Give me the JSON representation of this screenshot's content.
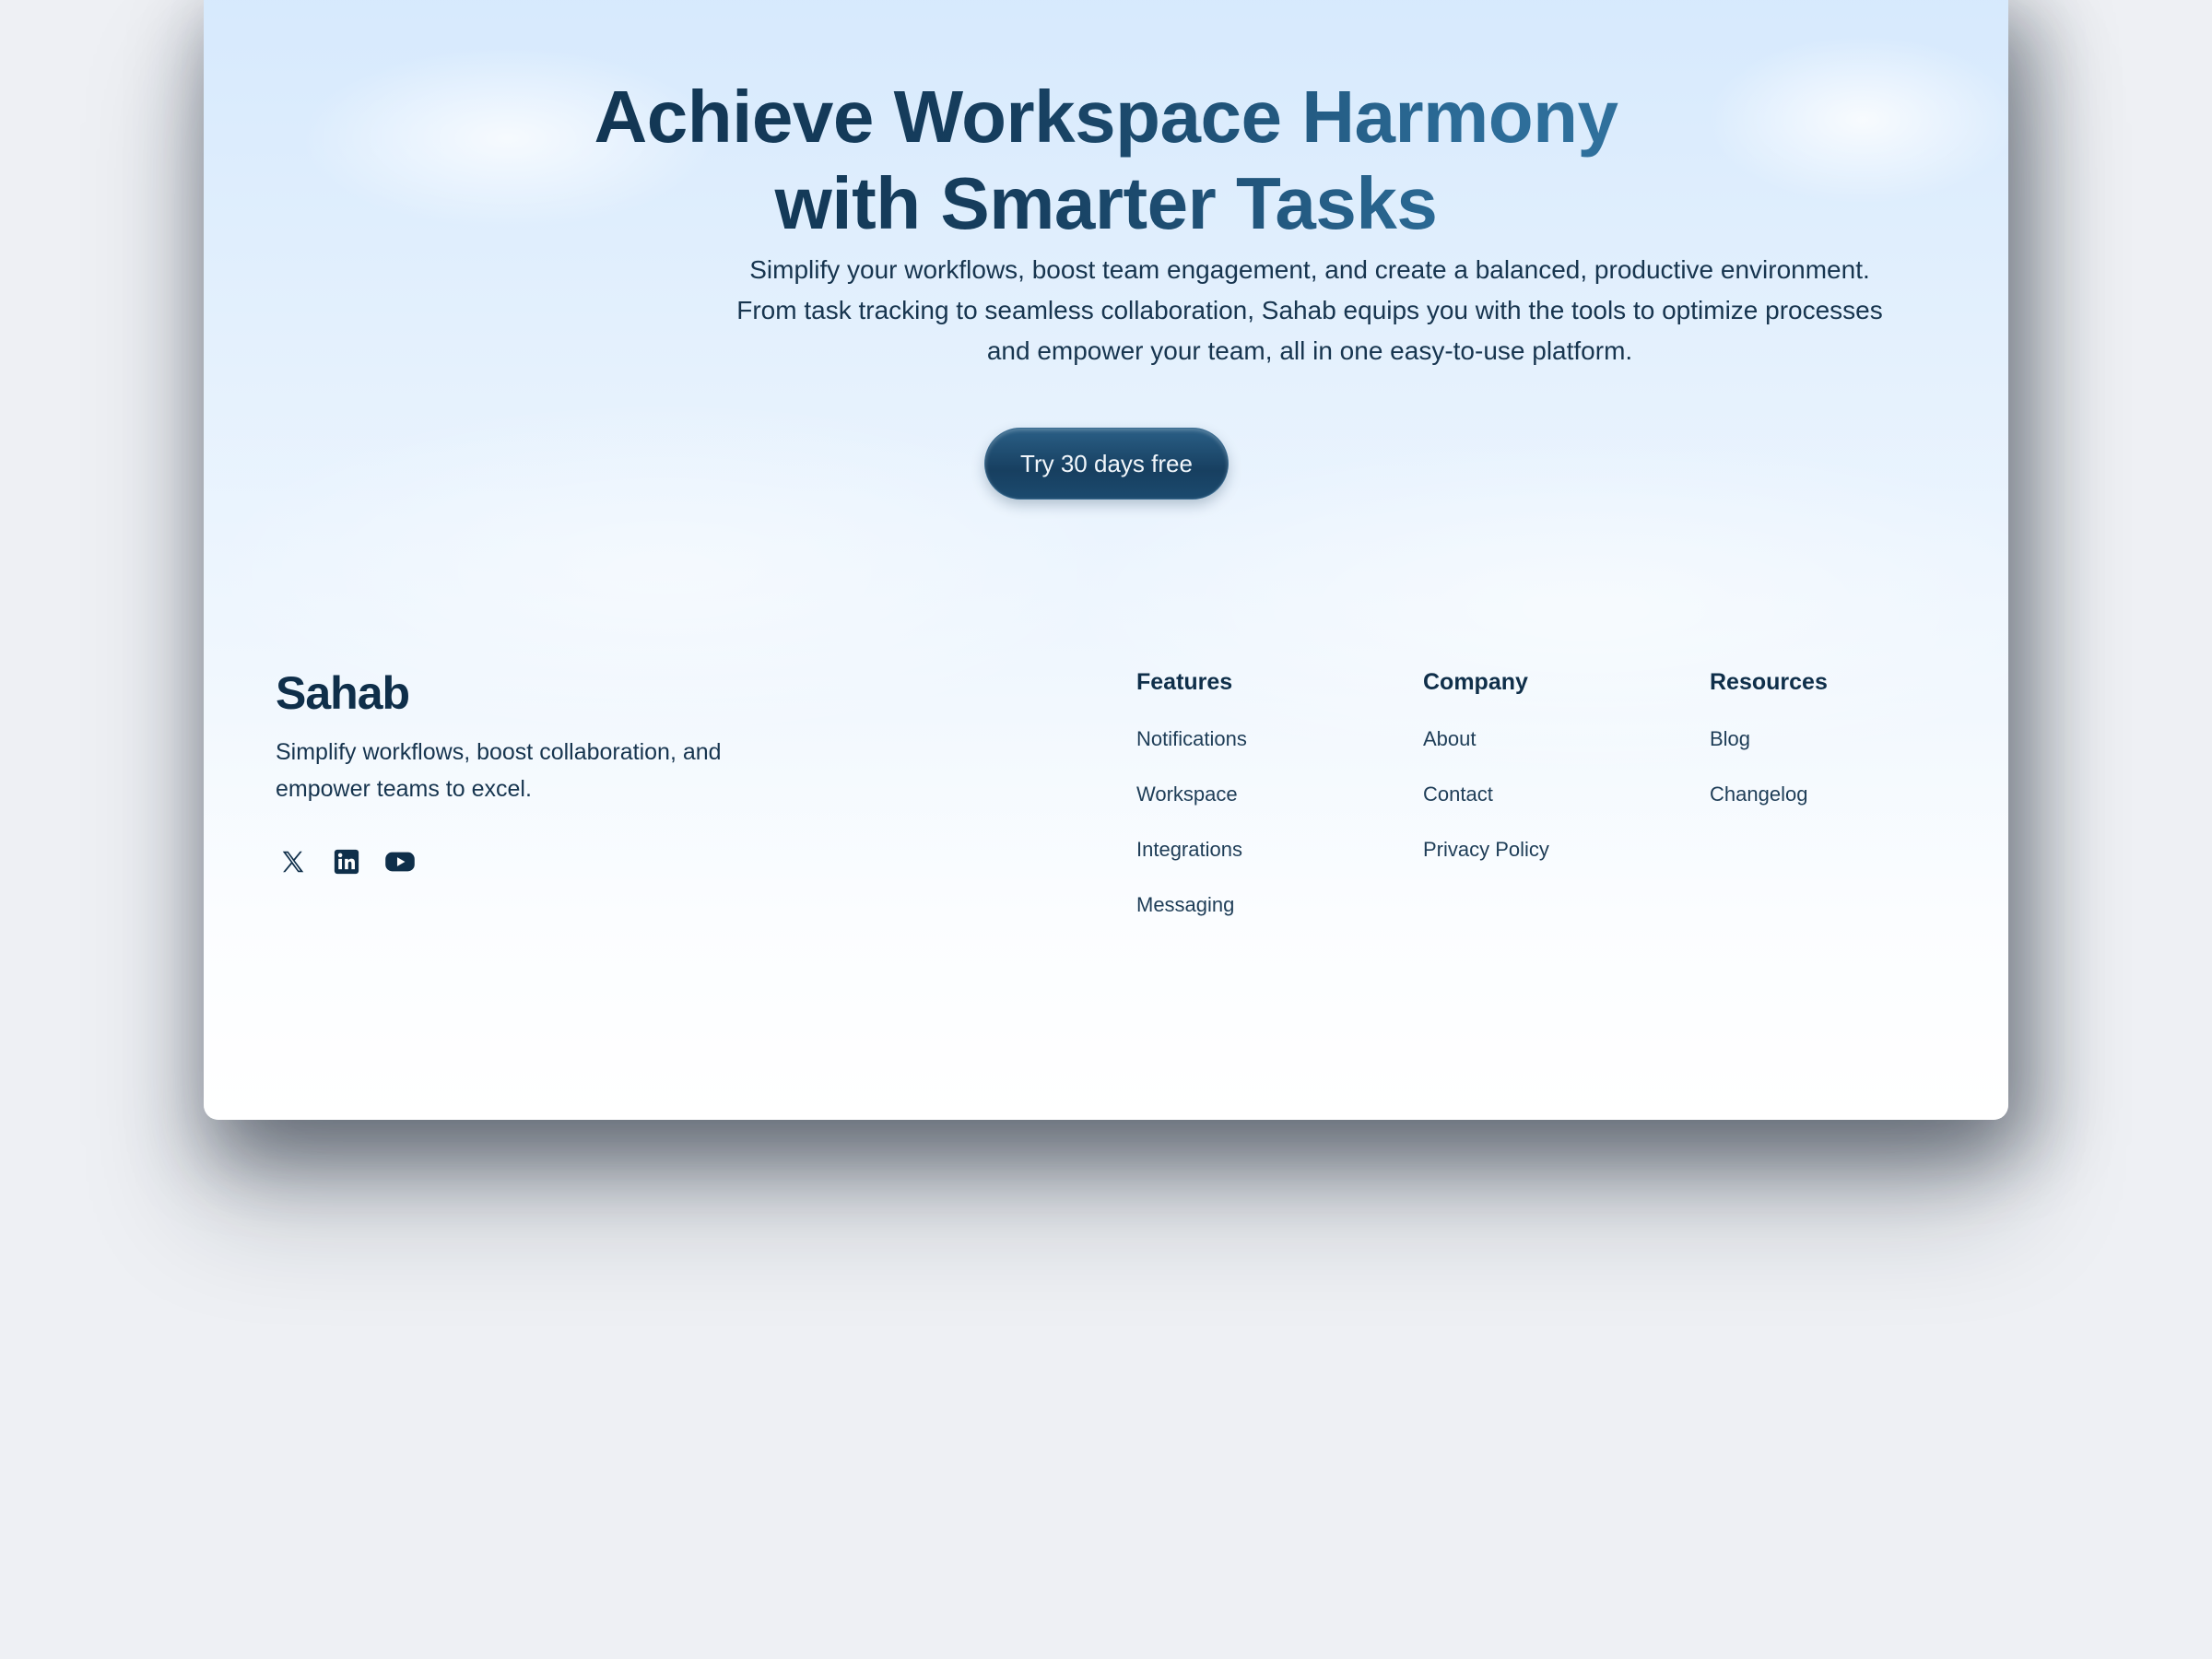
{
  "hero": {
    "title_line1": "Achieve Workspace Harmony",
    "title_line2": "with Smarter Tasks",
    "subtitle": "Simplify your workflows, boost team engagement, and create a balanced, productive environment. From task tracking to seamless collaboration, Sahab equips you with the tools to optimize processes and empower your team, all in one easy-to-use platform.",
    "cta_label": "Try 30 days free"
  },
  "footer": {
    "logo": "Sahab",
    "description": "Simplify workflows, boost collaboration, and empower teams to excel.",
    "socials": [
      {
        "icon": "x-icon"
      },
      {
        "icon": "linkedin-icon"
      },
      {
        "icon": "youtube-icon"
      }
    ],
    "columns": [
      {
        "heading": "Features",
        "links": [
          "Notifications",
          "Workspace",
          "Integrations",
          "Messaging"
        ]
      },
      {
        "heading": "Company",
        "links": [
          "About",
          "Contact",
          "Privacy Policy"
        ]
      },
      {
        "heading": "Resources",
        "links": [
          "Blog",
          "Changelog"
        ]
      }
    ]
  },
  "colors": {
    "brand_dark": "#0f2f4a",
    "brand_accent": "#3a7ca8",
    "button_bg": "#173f60",
    "page_bg": "#eef0f4"
  }
}
